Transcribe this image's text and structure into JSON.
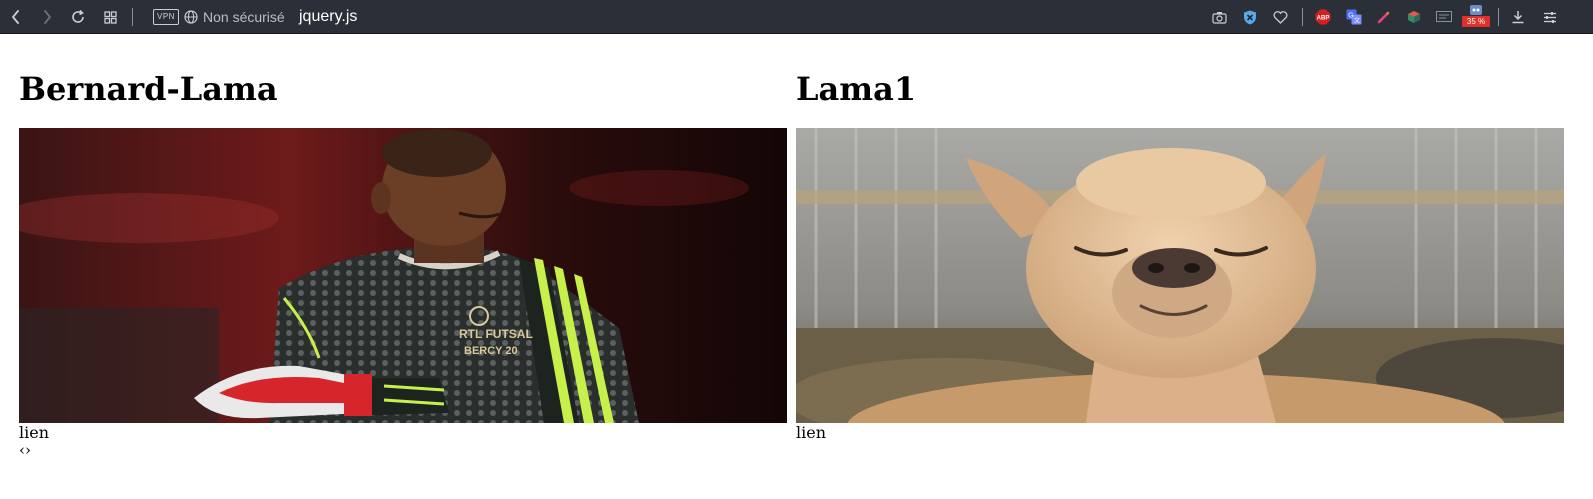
{
  "browser": {
    "vpn_label": "VPN",
    "security_text": "Non sécurisé",
    "url": "jquery.js",
    "badge_text": "35 %"
  },
  "cards": [
    {
      "title": "Bernard-Lama",
      "link_label": "lien"
    },
    {
      "title": "Lama1",
      "link_label": "lien"
    }
  ],
  "slider": {
    "arrows": "‹›"
  }
}
